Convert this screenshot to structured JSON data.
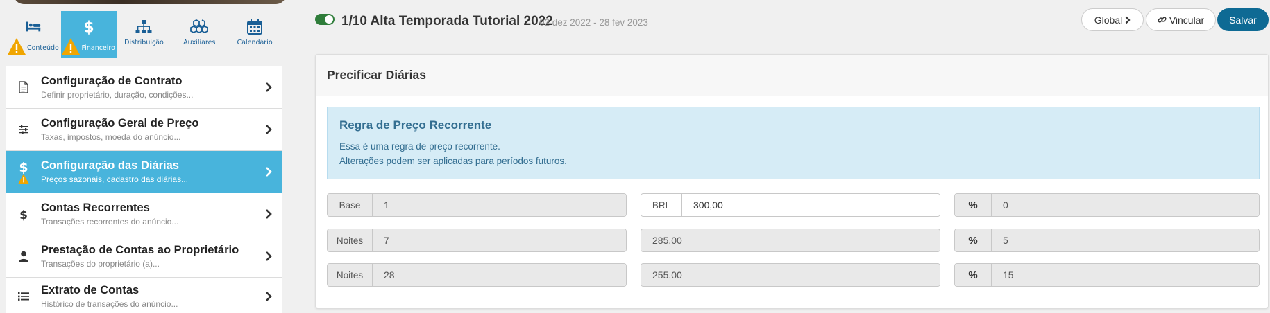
{
  "sidebar": {
    "tabs": [
      {
        "label": "Conteúdo",
        "icon": "bed-icon",
        "warning": true,
        "active": false
      },
      {
        "label": "Financeiro",
        "icon": "dollar-icon",
        "warning": true,
        "active": true
      },
      {
        "label": "Distribuição",
        "icon": "sitemap-icon",
        "warning": false,
        "active": false
      },
      {
        "label": "Auxiliares",
        "icon": "cubes-icon",
        "warning": false,
        "active": false
      },
      {
        "label": "Calendário",
        "icon": "calendar-icon",
        "warning": false,
        "active": false
      }
    ],
    "menu": [
      {
        "title": "Configuração de Contrato",
        "subtitle": "Definir proprietário, duração, condições...",
        "icon": "document-icon",
        "active": false
      },
      {
        "title": "Configuração Geral de Preço",
        "subtitle": "Taxas, impostos, moeda do anúncio...",
        "icon": "sliders-icon",
        "active": false
      },
      {
        "title": "Configuração das Diárias",
        "subtitle": "Preços sazonais, cadastro das diárias...",
        "icon": "dollar-icon",
        "active": true
      },
      {
        "title": "Contas Recorrentes",
        "subtitle": "Transações recorrentes do anúncio...",
        "icon": "dollar-icon",
        "active": false
      },
      {
        "title": "Prestação de Contas ao Proprietário",
        "subtitle": "Transações do proprietário (a)...",
        "icon": "user-icon",
        "active": false
      },
      {
        "title": "Extrato de Contas",
        "subtitle": "Histórico de transações do anúncio...",
        "icon": "list-icon",
        "active": false
      }
    ]
  },
  "header": {
    "title": "1/10 Alta Temporada Tutorial 2022",
    "dates": "02 dez 2022 - 28 fev 2023",
    "global_label": "Global",
    "vincular_label": "Vincular",
    "salvar_label": "Salvar"
  },
  "card": {
    "title": "Precificar Diárias",
    "info": {
      "title": "Regra de Preço Recorrente",
      "line1": "Essa é uma regra de preço recorrente.",
      "line2": "Alterações podem ser aplicadas para períodos futuros."
    },
    "rows": [
      {
        "label": "Base",
        "nights": "1",
        "currency": "BRL",
        "price": "300,00",
        "pct_label": "%",
        "pct": "0"
      },
      {
        "label": "Noites",
        "nights": "7",
        "currency": "",
        "price": "285.00",
        "pct_label": "%",
        "pct": "5"
      },
      {
        "label": "Noites",
        "nights": "28",
        "currency": "",
        "price": "255.00",
        "pct_label": "%",
        "pct": "15"
      }
    ]
  },
  "colors": {
    "accent": "#48b4dc",
    "primary": "#0e6a94",
    "toggle": "#2f7d3a",
    "warning": "#f0a500"
  }
}
